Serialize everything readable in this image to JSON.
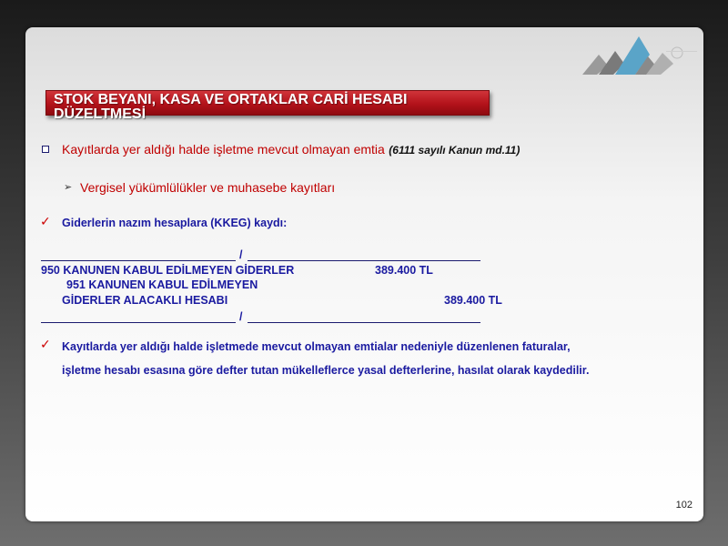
{
  "slide": {
    "title": "STOK BEYANI, KASA VE ORTAKLAR CARİ HESABI DÜZELTMESİ",
    "items": {
      "item1_main": "Kayıtlarda yer aldığı halde işletme mevcut olmayan emtia",
      "item1_note": "(6111 sayılı Kanun md.11)",
      "item2_sub": "Vergisel yükümlülükler ve muhasebe kayıtları",
      "item3": "Giderlerin nazım hesaplara (KKEG) kaydı:",
      "journal_separator": "/",
      "journal_debit_account": "950 KANUNEN KABUL EDİLMEYEN GİDERLER",
      "journal_debit_amount": "389.400 TL",
      "journal_credit_account_line1": "951 KANUNEN KABUL EDİLMEYEN",
      "journal_credit_account_line2": "GİDERLER ALACAKLI HESABI",
      "journal_credit_amount": "389.400 TL",
      "item4_line1": "Kayıtlarda yer aldığı halde işletmede mevcut olmayan emtialar nedeniyle düzenlenen faturalar,",
      "item4_line2": "işletme hesabı esasına göre defter tutan mükelleflerce yasal defterlerine, hasılat olarak kaydedilir."
    },
    "page_number": "102"
  },
  "icons": {
    "logo": "company-logo",
    "bullet_square": "square-bullet-icon",
    "bullet_arrow": "arrowhead-bullet-icon",
    "bullet_check": "checkmark-icon"
  },
  "colors": {
    "title_bar": "#b3121a",
    "red_text": "#c00000",
    "blue_text": "#1a1aa0"
  }
}
